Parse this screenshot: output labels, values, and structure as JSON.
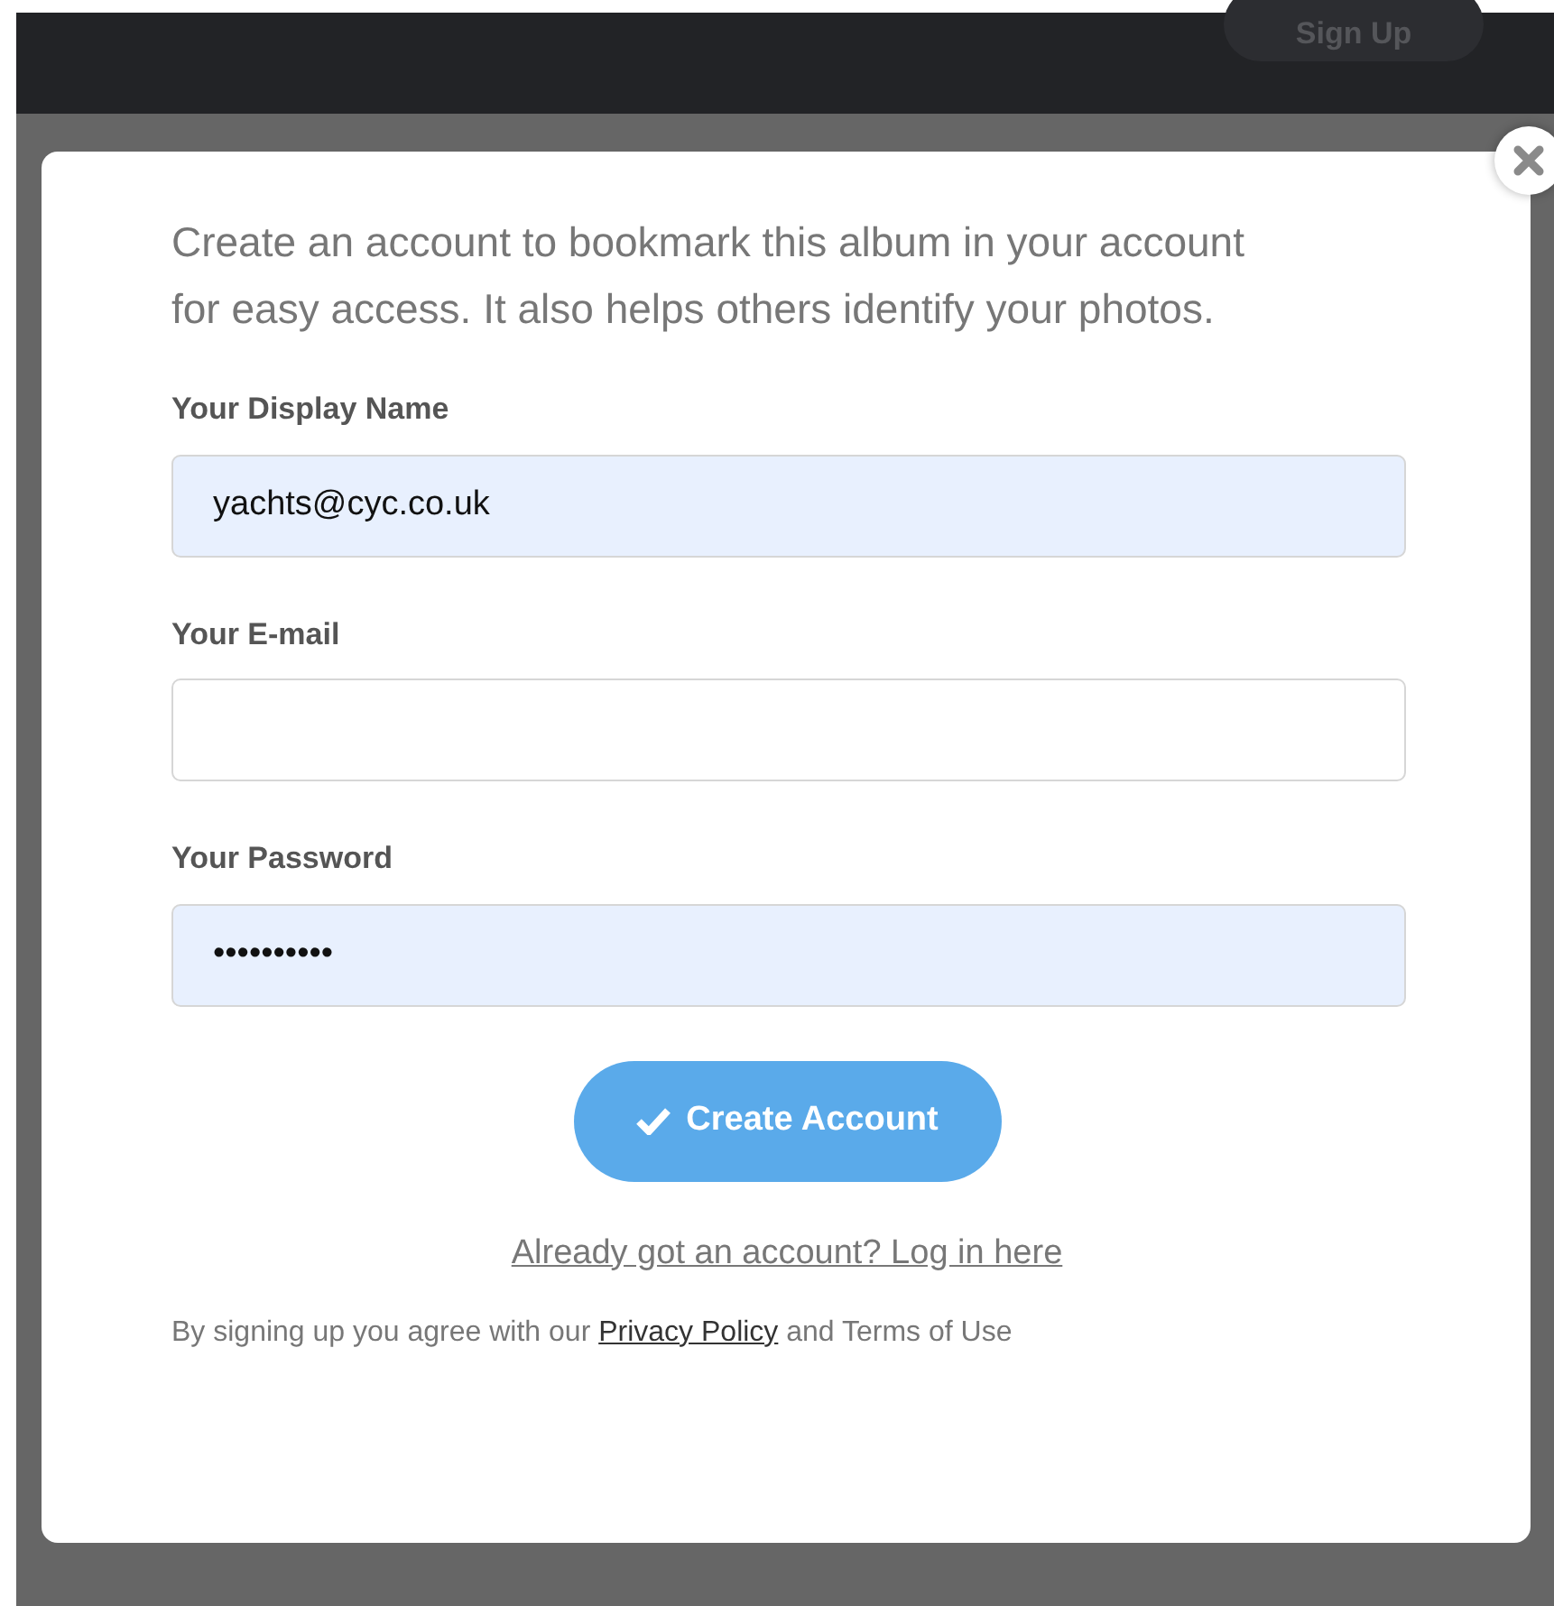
{
  "header": {
    "signup_button": "Sign Up"
  },
  "modal": {
    "intro": "Create an account to bookmark this album in your account for easy access. It also helps others identify your photos.",
    "fields": [
      {
        "label": "Your Display Name",
        "value": "yachts@cyc.co.uk",
        "autofilled": true
      },
      {
        "label": "Your E-mail",
        "autofilled": false
      },
      {
        "label": "Your Password",
        "value": "••••••••••",
        "autofilled": true
      }
    ],
    "submit_button": "Create Account",
    "login_link": "Already got an account? Log in here",
    "terms": {
      "before": "By signing up you agree with our",
      "link": "Privacy Policy",
      "after": "and Terms of Use"
    }
  }
}
